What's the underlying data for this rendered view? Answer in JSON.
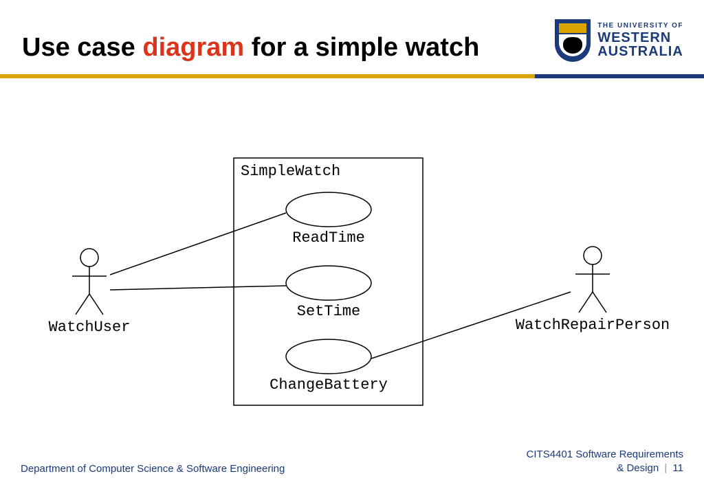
{
  "title": {
    "pre": "Use case ",
    "highlight": "diagram",
    "post": " for a simple watch"
  },
  "logo": {
    "line1": "THE UNIVERSITY OF",
    "line2": "WESTERN",
    "line3": "AUSTRALIA"
  },
  "diagram": {
    "system": "SimpleWatch",
    "usecases": {
      "uc1": "ReadTime",
      "uc2": "SetTime",
      "uc3": "ChangeBattery"
    },
    "actors": {
      "left": "WatchUser",
      "right": "WatchRepairPerson"
    }
  },
  "footer": {
    "left": "Department of Computer Science & Software Engineering",
    "course": "CITS4401 Software Requirements",
    "tail": "& Design",
    "page": "11"
  },
  "chart_data": {
    "type": "diagram",
    "title": "Use case diagram for a simple watch",
    "system": "SimpleWatch",
    "actors": [
      "WatchUser",
      "WatchRepairPerson"
    ],
    "usecases": [
      "ReadTime",
      "SetTime",
      "ChangeBattery"
    ],
    "associations": [
      {
        "actor": "WatchUser",
        "usecase": "ReadTime"
      },
      {
        "actor": "WatchUser",
        "usecase": "SetTime"
      },
      {
        "actor": "WatchRepairPerson",
        "usecase": "ChangeBattery"
      }
    ]
  }
}
